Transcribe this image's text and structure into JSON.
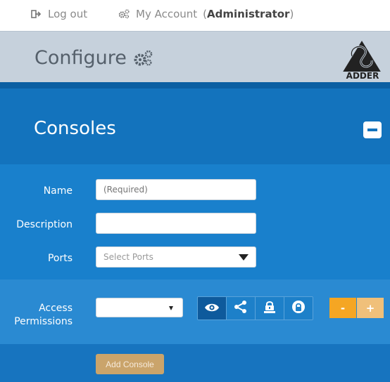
{
  "top_links": {
    "logout_label": "Log out",
    "account_label": "My Account",
    "role_open": "(",
    "role": "Administrator",
    "role_close": ")"
  },
  "header": {
    "title": "Configure",
    "logo_text": "ADDER"
  },
  "section": {
    "title": "Consoles"
  },
  "form": {
    "name_label": "Name",
    "name_placeholder": "(Required)",
    "description_label": "Description",
    "ports_label": "Ports",
    "ports_placeholder": "Select Ports",
    "access_label_line1": "Access",
    "access_label_line2": "Permissions",
    "add_button_label": "Add Console"
  },
  "permissions": {
    "buttons": [
      {
        "icon": "eye-icon",
        "active": true
      },
      {
        "icon": "share-icon",
        "active": false
      },
      {
        "icon": "exclusive-lock-icon",
        "active": false
      },
      {
        "icon": "lock-icon",
        "active": false
      }
    ],
    "minus_label": "-",
    "plus_label": "+"
  },
  "colors": {
    "accent_blue": "#1373bd",
    "orange": "#f5a623",
    "add_button": "#caa46b"
  }
}
